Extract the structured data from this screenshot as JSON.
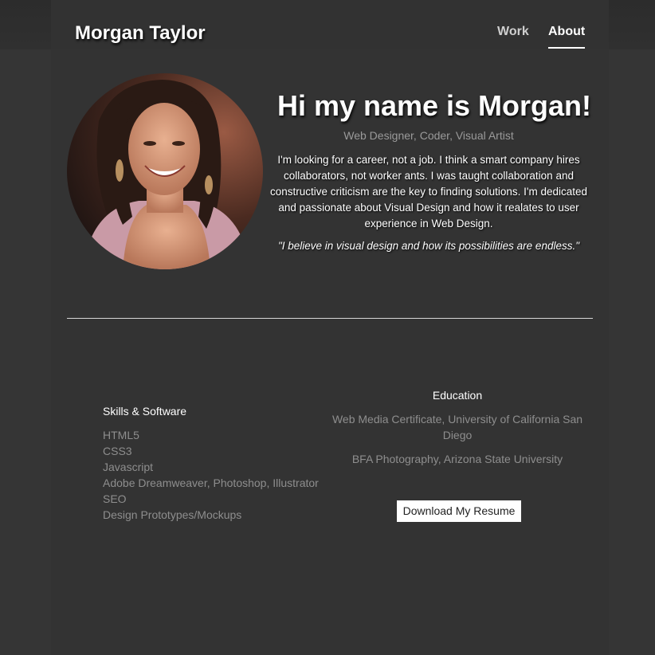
{
  "header": {
    "site_title": "Morgan Taylor",
    "nav": [
      {
        "label": "Work"
      },
      {
        "label": "About"
      }
    ]
  },
  "hero": {
    "title": "Hi my name is Morgan!",
    "subtitle": "Web Designer, Coder, Visual Artist",
    "bio": "I'm looking for a career, not a job. I think a smart company hires collaborators, not worker ants. I was taught collaboration and constructive criticism are the key to finding solutions. I'm dedicated and passionate about Visual Design and how it realates to user experience in Web Design.",
    "quote": "\"I believe in visual design and how its possibilities are endless.\""
  },
  "skills": {
    "title": "Skills & Software",
    "items": [
      "HTML5",
      "CSS3",
      "Javascript",
      "Adobe Dreamweaver, Photoshop, Illustrator",
      "SEO",
      "Design Prototypes/Mockups"
    ]
  },
  "education": {
    "title": "Education",
    "items": [
      "Web Media Certificate, University of California San Diego",
      "BFA Photography, Arizona State University"
    ]
  },
  "resume_button": {
    "label": "Download My Resume"
  },
  "colors": {
    "background": "#353535",
    "page": "#333333",
    "text": "#ffffff",
    "muted": "#8e8e8e"
  }
}
